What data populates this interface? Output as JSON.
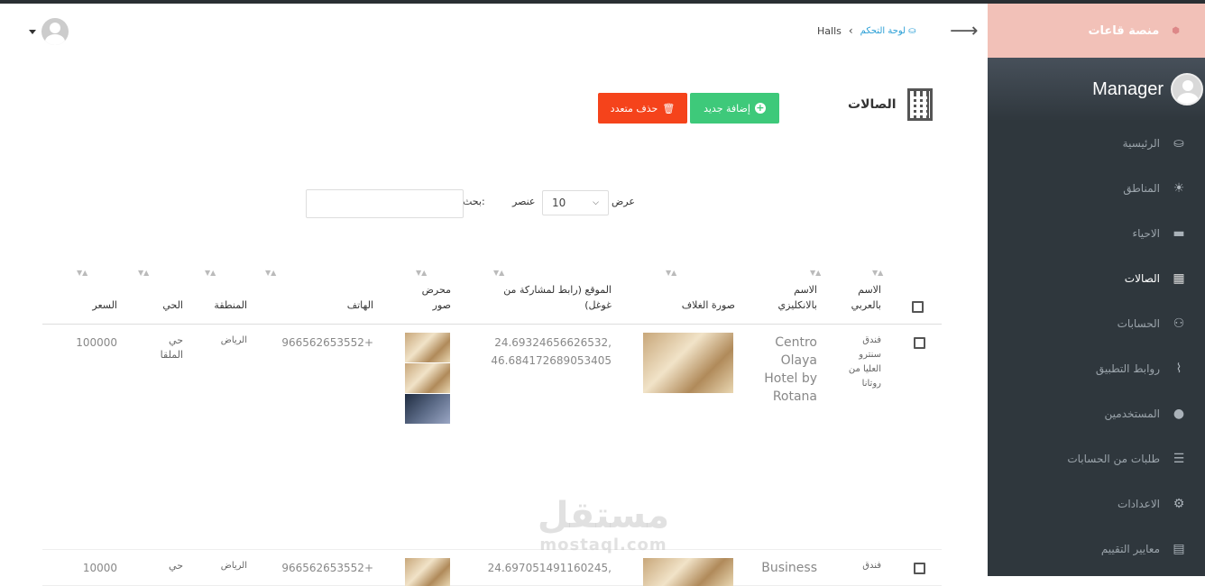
{
  "brand": {
    "name": "منصة قاعات",
    "icon": "logo-icon"
  },
  "user": {
    "name": "Manager"
  },
  "sidebar": {
    "items": [
      {
        "label": "الرئيسية",
        "icon": "dashboard-icon"
      },
      {
        "label": "المناطق",
        "icon": "bulb-icon"
      },
      {
        "label": "الاحياء",
        "icon": "folder-icon"
      },
      {
        "label": "الصالات",
        "icon": "building-icon",
        "active": true
      },
      {
        "label": "الحسابات",
        "icon": "users-icon"
      },
      {
        "label": "روابط التطبيق",
        "icon": "paperclip-icon"
      },
      {
        "label": "المستخدمين",
        "icon": "user-icon"
      },
      {
        "label": "طلبات من الحسابات",
        "icon": "list-icon"
      },
      {
        "label": "الاعدادات",
        "icon": "gear-icon"
      },
      {
        "label": "معايير التقييم",
        "icon": "book-icon"
      }
    ]
  },
  "breadcrumb": {
    "home": "لوحة التحكم",
    "current": "Halls"
  },
  "page": {
    "title": "الصالات"
  },
  "buttons": {
    "add": "إضافة جديد",
    "bulk_delete": "حذف متعدد"
  },
  "controls": {
    "show_label": "عرض",
    "length_value": "10",
    "items_label": "عنصر",
    "search_label": "بحث:",
    "search_value": ""
  },
  "table": {
    "headers": {
      "name_ar": "الاسم بالعربي",
      "name_en": "الاسم بالانكليزي",
      "cover": "صورة الغلاف",
      "location": "الموقع (رابط لمشاركة من غوغل)",
      "gallery": "محرض صور",
      "phone": "الهاتف",
      "region": "المنطقة",
      "district": "الحي",
      "price": "السعر"
    },
    "rows": [
      {
        "name_ar": "فندق سنترو العليا من روتانا",
        "name_en": "Centro Olaya Hotel by Rotana",
        "location": "24.69324656626532, 46.684172689053405",
        "phone": "966562653552+",
        "region": "الرياض",
        "district": "حي الملقا",
        "price": "100000"
      },
      {
        "name_ar": "فندق",
        "name_en": "Business",
        "location": "24.697051491160245,",
        "phone": "966562653552+",
        "region": "الرياض",
        "district": "حي",
        "price": "10000"
      }
    ]
  },
  "watermark": {
    "ar": "مستقل",
    "en": "mostaql.com"
  }
}
